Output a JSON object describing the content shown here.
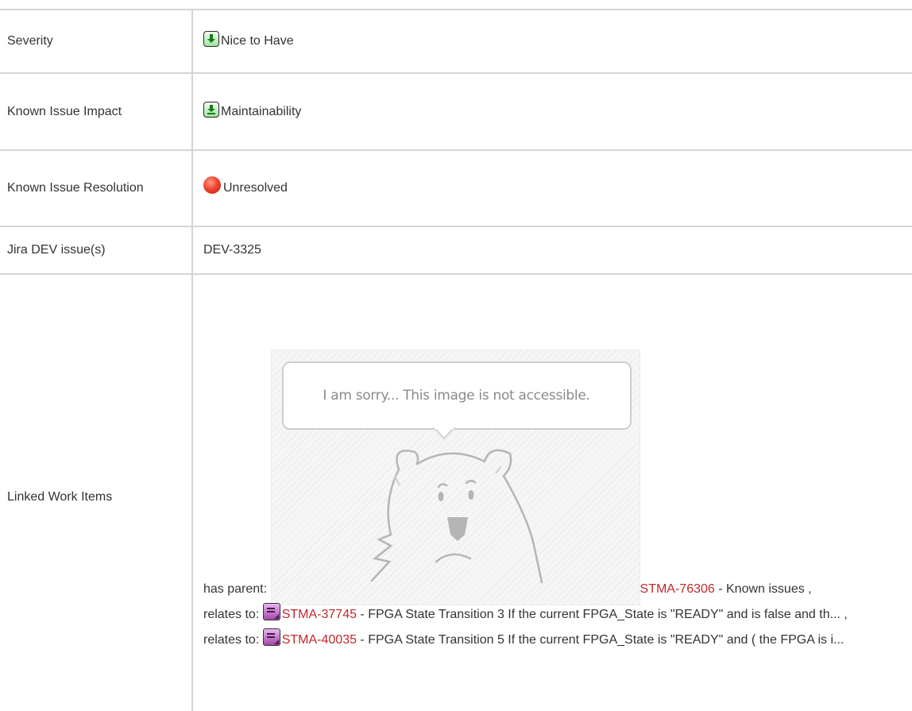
{
  "rows": {
    "severity": {
      "label": "Severity",
      "value": "Nice to Have",
      "icon": "green-down-arrow-icon"
    },
    "impact": {
      "label": "Known Issue Impact",
      "value": "Maintainability",
      "icon": "green-down-arrow-icon"
    },
    "resolution": {
      "label": "Known Issue Resolution",
      "value": "Unresolved",
      "icon": "red-dot-icon"
    },
    "jira": {
      "label": "Jira DEV issue(s)",
      "value": "DEV-3325"
    },
    "linked": {
      "label": "Linked Work Items",
      "image_placeholder_text": "I am sorry... This image is not accessible.",
      "items": [
        {
          "relation": "has parent:",
          "id": "STMA-76306",
          "title": " - Known issues ,"
        },
        {
          "relation": "relates to:",
          "id": "STMA-37745",
          "title": " - FPGA State Transition 3 If the current FPGA_State is \"READY\" and is false and th... ,",
          "icon": "work-item-icon"
        },
        {
          "relation": "relates to:",
          "id": "STMA-40035",
          "title": " - FPGA State Transition 5 If the current FPGA_State is \"READY\" and ( the FPGA is i...",
          "icon": "work-item-icon"
        }
      ]
    }
  },
  "colors": {
    "link": "#c0282d",
    "border": "#d4d4d4",
    "text": "#333333"
  }
}
